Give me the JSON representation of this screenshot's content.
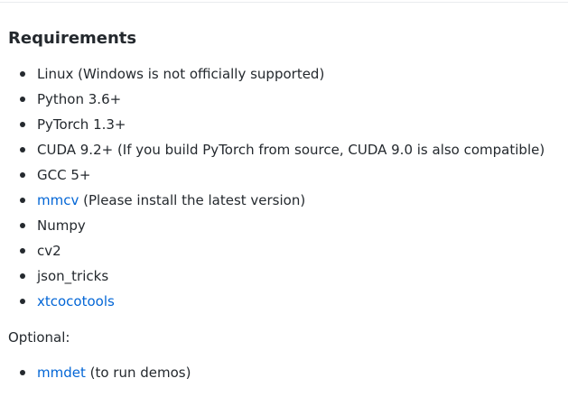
{
  "section": {
    "title": "Requirements"
  },
  "requirements": [
    {
      "text": "Linux (Windows is not officially supported)"
    },
    {
      "text": "Python 3.6+"
    },
    {
      "text": "PyTorch 1.3+"
    },
    {
      "text": "CUDA 9.2+ (If you build PyTorch from source, CUDA 9.0 is also compatible)"
    },
    {
      "text": "GCC 5+"
    },
    {
      "link": "mmcv",
      "text": " (Please install the latest version)"
    },
    {
      "text": "Numpy"
    },
    {
      "text": "cv2"
    },
    {
      "text": "json_tricks"
    },
    {
      "link": "xtcocotools"
    }
  ],
  "optional": {
    "label": "Optional:",
    "items": [
      {
        "link": "mmdet",
        "text": " (to run demos)"
      }
    ]
  },
  "colors": {
    "text": "#24292e",
    "link": "#0366d6",
    "rule": "#eaecef"
  }
}
